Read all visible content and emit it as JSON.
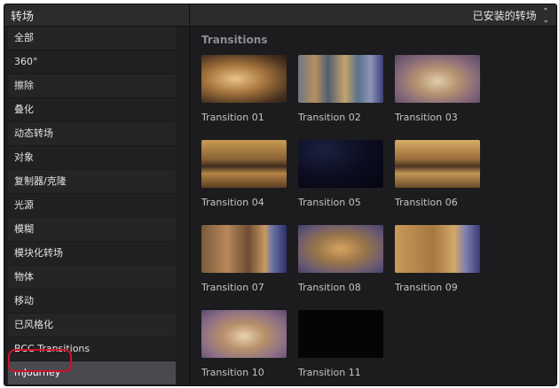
{
  "header": {
    "title": "转场",
    "installed_label": "已安装的转场",
    "stepper_icon": "up-down-chevron-icon"
  },
  "sidebar": {
    "items": [
      {
        "label": "全部"
      },
      {
        "label": "360°"
      },
      {
        "label": "擦除"
      },
      {
        "label": "叠化"
      },
      {
        "label": "动态转场"
      },
      {
        "label": "对象"
      },
      {
        "label": "复制器/克隆"
      },
      {
        "label": "光源"
      },
      {
        "label": "模糊"
      },
      {
        "label": "模块化转场"
      },
      {
        "label": "物体"
      },
      {
        "label": "移动"
      },
      {
        "label": "已风格化"
      },
      {
        "label": "BCC Transitions"
      },
      {
        "label": "mJourney",
        "selected": true
      }
    ]
  },
  "main": {
    "section_title": "Transitions",
    "transitions": [
      {
        "label": "Transition 01"
      },
      {
        "label": "Transition 02"
      },
      {
        "label": "Transition 03"
      },
      {
        "label": "Transition 04"
      },
      {
        "label": "Transition 05"
      },
      {
        "label": "Transition 06"
      },
      {
        "label": "Transition 07"
      },
      {
        "label": "Transition 08"
      },
      {
        "label": "Transition 09"
      },
      {
        "label": "Transition 10"
      },
      {
        "label": "Transition 11"
      }
    ]
  },
  "colors": {
    "background": "#1c1c1e",
    "header": "#2c2c2e",
    "selected_item": "#4a4a4e",
    "highlight_ring": "#d1112c"
  }
}
